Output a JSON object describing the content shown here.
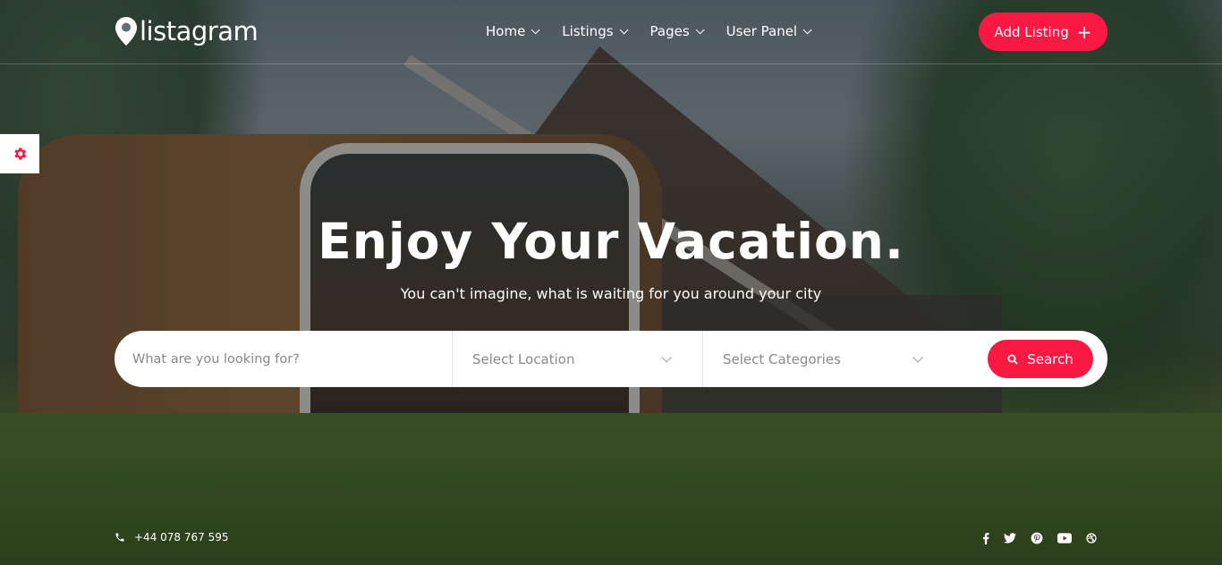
{
  "brand": {
    "name": "listagram",
    "accent": "#f91942"
  },
  "nav": {
    "items": [
      {
        "label": "Home"
      },
      {
        "label": "Listings"
      },
      {
        "label": "Pages"
      },
      {
        "label": "User Panel"
      }
    ],
    "add_listing_label": "Add Listing",
    "add_listing_icon": "plus-icon"
  },
  "settings": {
    "icon": "gear-icon"
  },
  "hero": {
    "title": "Enjoy Your Vacation.",
    "subtitle": "You can't imagine, what is waiting for you around your city"
  },
  "search": {
    "what_placeholder": "What are you looking for?",
    "location_label": "Select Location",
    "categories_label": "Select Categories",
    "button_label": "Search",
    "button_icon": "search-icon"
  },
  "footer": {
    "phone": "+44 078 767 595",
    "phone_icon": "phone-icon",
    "socials": [
      "facebook-icon",
      "twitter-icon",
      "pinterest-icon",
      "youtube-icon",
      "dribbble-icon"
    ]
  }
}
